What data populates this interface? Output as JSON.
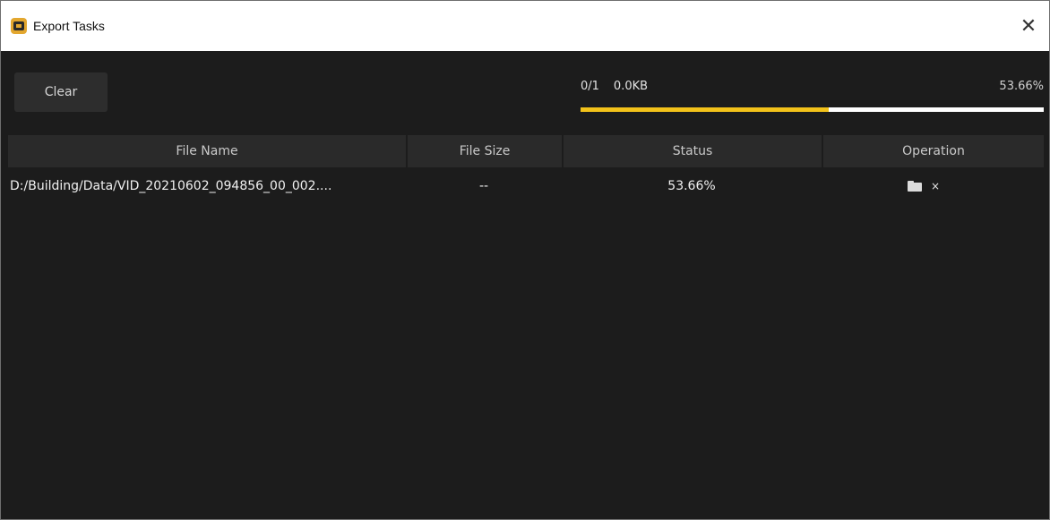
{
  "window": {
    "title": "Export Tasks",
    "close_glyph": "✕"
  },
  "toolbar": {
    "clear_label": "Clear"
  },
  "progress": {
    "count": "0/1",
    "size": "0.0KB",
    "percent_text": "53.66%",
    "fraction": 0.5366
  },
  "table": {
    "headers": {
      "file_name": "File Name",
      "file_size": "File Size",
      "status": "Status",
      "operation": "Operation"
    },
    "rows": [
      {
        "file_name": "D:/Building/Data/VID_20210602_094856_00_002....",
        "file_size": "--",
        "status": "53.66%",
        "operations": [
          "folder-icon",
          "close-icon"
        ],
        "remove_glyph": "×"
      }
    ]
  },
  "colors": {
    "accent": "#f2c21a",
    "background": "#1c1c1c",
    "header": "#2a2a2a"
  }
}
